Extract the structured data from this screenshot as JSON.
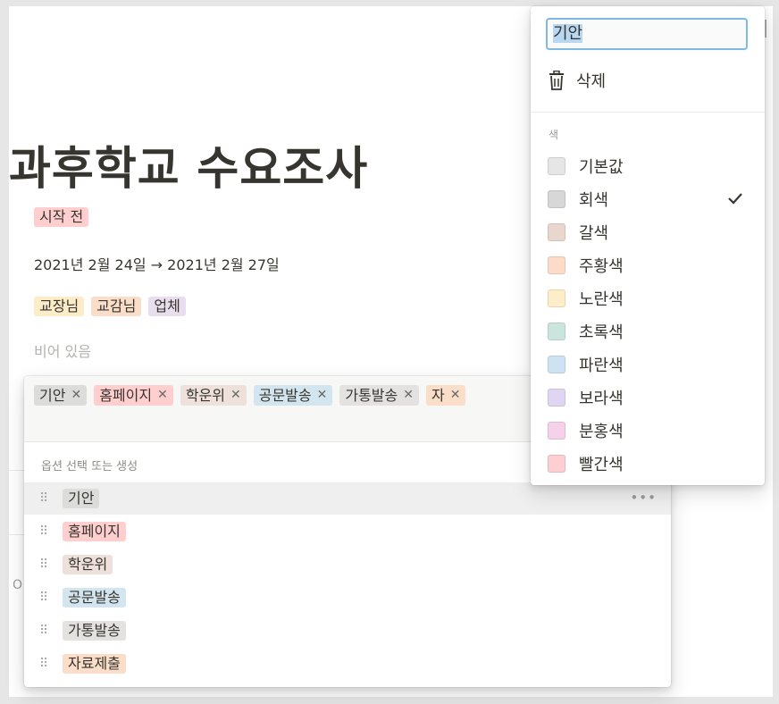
{
  "page": {
    "title": "과후학교 수요조사",
    "status": {
      "label": "시작 전",
      "color": "#ffcfd0"
    },
    "date_range": "2021년 2월 24일 → 2021년 2월 27일",
    "people": [
      {
        "label": "교장님",
        "color": "#fdecc8"
      },
      {
        "label": "교감님",
        "color": "#fadec9"
      },
      {
        "label": "업체",
        "color": "#e8deee"
      }
    ],
    "empty_text": "비어 있음",
    "side_text": "O"
  },
  "multiselect": {
    "selected_chips": [
      {
        "label": "기안",
        "color": "#dcdcdb"
      },
      {
        "label": "홈페이지",
        "color": "#ffcfd0"
      },
      {
        "label": "학운위",
        "color": "#eee0da"
      },
      {
        "label": "공문발송",
        "color": "#d3e5ef"
      },
      {
        "label": "가통발송",
        "color": "#e3e2e0"
      },
      {
        "label": "자",
        "color": "#fadec9"
      }
    ],
    "remove_glyph": "✕",
    "hint": "옵션 선택 또는 생성",
    "options": [
      {
        "label": "기안",
        "color": "#dcdcdb"
      },
      {
        "label": "홈페이지",
        "color": "#ffcfd0"
      },
      {
        "label": "학운위",
        "color": "#eee0da"
      },
      {
        "label": "공문발송",
        "color": "#d3e5ef"
      },
      {
        "label": "가통발송",
        "color": "#e3e2e0"
      },
      {
        "label": "자료제출",
        "color": "#fadec9"
      }
    ],
    "more_glyph": "•••",
    "handle_glyph": "⠿"
  },
  "color_menu": {
    "name_value": "기안",
    "delete_label": "삭제",
    "section_label": "색",
    "selected_index": 1,
    "colors": [
      {
        "label": "기본값",
        "swatch": "#e6e6e6"
      },
      {
        "label": "회색",
        "swatch": "#d7d7d7"
      },
      {
        "label": "갈색",
        "swatch": "#e9d6cc"
      },
      {
        "label": "주황색",
        "swatch": "#fcdcc8"
      },
      {
        "label": "노란색",
        "swatch": "#fdedc8"
      },
      {
        "label": "초록색",
        "swatch": "#c9e5de"
      },
      {
        "label": "파란색",
        "swatch": "#cde3f3"
      },
      {
        "label": "보라색",
        "swatch": "#e0d6f3"
      },
      {
        "label": "분홍색",
        "swatch": "#f6d1ea"
      },
      {
        "label": "빨간색",
        "swatch": "#fecfd2"
      }
    ]
  }
}
